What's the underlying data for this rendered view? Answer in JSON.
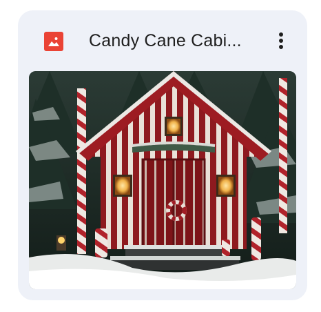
{
  "file": {
    "title": "Candy Cane Cabi...",
    "type_icon": "image-file-icon",
    "type_icon_color": "#ea4335"
  },
  "actions": {
    "more_icon": "more-vert-icon"
  },
  "thumbnail": {
    "subject": "candy-cane-cabin-photo"
  },
  "colors": {
    "card_background": "#eef1f8",
    "title_text": "#1f1f1f"
  }
}
